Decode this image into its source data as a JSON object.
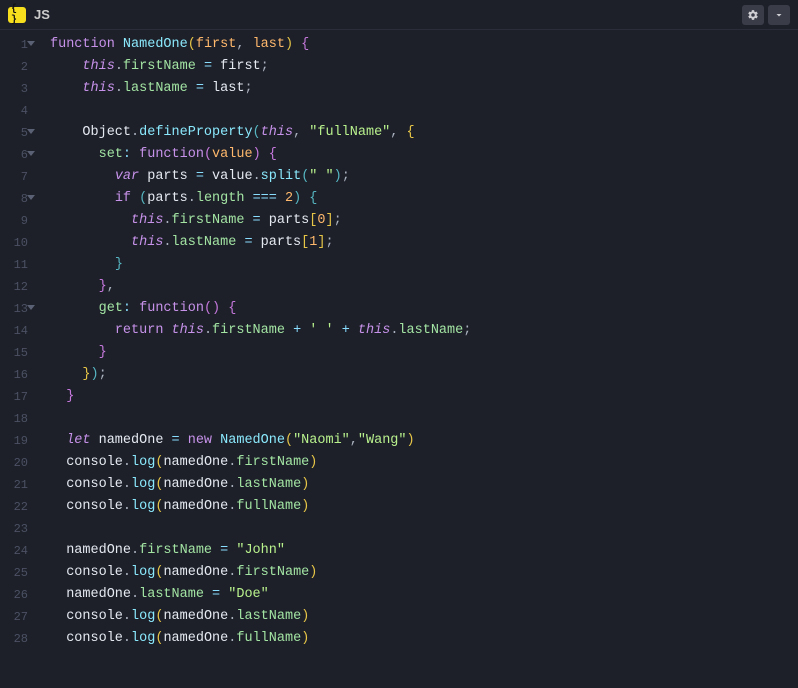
{
  "titlebar": {
    "js_badge": "{ }",
    "js_label": "JS"
  },
  "lines": [
    {
      "n": 1,
      "fold": true,
      "tokens": [
        [
          "kw",
          "function "
        ],
        [
          "fn",
          "NamedOne"
        ],
        [
          "paren",
          "("
        ],
        [
          "var",
          "first"
        ],
        [
          "punc",
          ", "
        ],
        [
          "var",
          "last"
        ],
        [
          "paren",
          ") "
        ],
        [
          "paren2",
          "{"
        ]
      ]
    },
    {
      "n": 2,
      "fold": false,
      "tokens": [
        [
          "",
          "    "
        ],
        [
          "this",
          "this"
        ],
        [
          "punc",
          "."
        ],
        [
          "prop",
          "firstName"
        ],
        [
          "op",
          " = "
        ],
        [
          "ident",
          "first"
        ],
        [
          "punc",
          ";"
        ]
      ]
    },
    {
      "n": 3,
      "fold": false,
      "tokens": [
        [
          "",
          "    "
        ],
        [
          "this",
          "this"
        ],
        [
          "punc",
          "."
        ],
        [
          "prop",
          "lastName"
        ],
        [
          "op",
          " = "
        ],
        [
          "ident",
          "last"
        ],
        [
          "punc",
          ";"
        ]
      ]
    },
    {
      "n": 4,
      "fold": false,
      "tokens": []
    },
    {
      "n": 5,
      "fold": true,
      "tokens": [
        [
          "",
          "    "
        ],
        [
          "ident",
          "Object"
        ],
        [
          "punc",
          "."
        ],
        [
          "fn",
          "defineProperty"
        ],
        [
          "paren3",
          "("
        ],
        [
          "this",
          "this"
        ],
        [
          "punc",
          ", "
        ],
        [
          "str",
          "\"fullName\""
        ],
        [
          "punc",
          ", "
        ],
        [
          "paren",
          "{"
        ]
      ]
    },
    {
      "n": 6,
      "fold": true,
      "tokens": [
        [
          "",
          "      "
        ],
        [
          "prop",
          "set"
        ],
        [
          "op",
          ": "
        ],
        [
          "kw",
          "function"
        ],
        [
          "paren2",
          "("
        ],
        [
          "var",
          "value"
        ],
        [
          "paren2",
          ") "
        ],
        [
          "paren2",
          "{"
        ]
      ]
    },
    {
      "n": 7,
      "fold": false,
      "tokens": [
        [
          "",
          "        "
        ],
        [
          "kw2",
          "var "
        ],
        [
          "ident",
          "parts"
        ],
        [
          "op",
          " = "
        ],
        [
          "ident",
          "value"
        ],
        [
          "punc",
          "."
        ],
        [
          "fn",
          "split"
        ],
        [
          "paren3",
          "("
        ],
        [
          "str",
          "\" \""
        ],
        [
          "paren3",
          ")"
        ],
        [
          "punc",
          ";"
        ]
      ]
    },
    {
      "n": 8,
      "fold": true,
      "tokens": [
        [
          "",
          "        "
        ],
        [
          "kw",
          "if "
        ],
        [
          "paren3",
          "("
        ],
        [
          "ident",
          "parts"
        ],
        [
          "punc",
          "."
        ],
        [
          "prop",
          "length"
        ],
        [
          "op",
          " === "
        ],
        [
          "num",
          "2"
        ],
        [
          "paren3",
          ") "
        ],
        [
          "paren3",
          "{"
        ]
      ]
    },
    {
      "n": 9,
      "fold": false,
      "tokens": [
        [
          "",
          "          "
        ],
        [
          "this",
          "this"
        ],
        [
          "punc",
          "."
        ],
        [
          "prop",
          "firstName"
        ],
        [
          "op",
          " = "
        ],
        [
          "ident",
          "parts"
        ],
        [
          "paren",
          "["
        ],
        [
          "num",
          "0"
        ],
        [
          "paren",
          "]"
        ],
        [
          "punc",
          ";"
        ]
      ]
    },
    {
      "n": 10,
      "fold": false,
      "tokens": [
        [
          "",
          "          "
        ],
        [
          "this",
          "this"
        ],
        [
          "punc",
          "."
        ],
        [
          "prop",
          "lastName"
        ],
        [
          "op",
          " = "
        ],
        [
          "ident",
          "parts"
        ],
        [
          "paren",
          "["
        ],
        [
          "num",
          "1"
        ],
        [
          "paren",
          "]"
        ],
        [
          "punc",
          ";"
        ]
      ]
    },
    {
      "n": 11,
      "fold": false,
      "tokens": [
        [
          "",
          "        "
        ],
        [
          "paren3",
          "}"
        ]
      ]
    },
    {
      "n": 12,
      "fold": false,
      "tokens": [
        [
          "",
          "      "
        ],
        [
          "paren2",
          "}"
        ],
        [
          "punc",
          ","
        ]
      ]
    },
    {
      "n": 13,
      "fold": true,
      "tokens": [
        [
          "",
          "      "
        ],
        [
          "prop",
          "get"
        ],
        [
          "op",
          ": "
        ],
        [
          "kw",
          "function"
        ],
        [
          "paren2",
          "("
        ],
        [
          "paren2",
          ") "
        ],
        [
          "paren2",
          "{"
        ]
      ]
    },
    {
      "n": 14,
      "fold": false,
      "tokens": [
        [
          "",
          "        "
        ],
        [
          "kw",
          "return "
        ],
        [
          "this",
          "this"
        ],
        [
          "punc",
          "."
        ],
        [
          "prop",
          "firstName"
        ],
        [
          "op",
          " + "
        ],
        [
          "str",
          "' '"
        ],
        [
          "op",
          " + "
        ],
        [
          "this",
          "this"
        ],
        [
          "punc",
          "."
        ],
        [
          "prop",
          "lastName"
        ],
        [
          "punc",
          ";"
        ]
      ]
    },
    {
      "n": 15,
      "fold": false,
      "tokens": [
        [
          "",
          "      "
        ],
        [
          "paren2",
          "}"
        ]
      ]
    },
    {
      "n": 16,
      "fold": false,
      "tokens": [
        [
          "",
          "    "
        ],
        [
          "paren",
          "}"
        ],
        [
          "paren3",
          ")"
        ],
        [
          "punc",
          ";"
        ]
      ]
    },
    {
      "n": 17,
      "fold": false,
      "tokens": [
        [
          "",
          "  "
        ],
        [
          "paren2",
          "}"
        ]
      ]
    },
    {
      "n": 18,
      "fold": false,
      "tokens": []
    },
    {
      "n": 19,
      "fold": false,
      "tokens": [
        [
          "",
          "  "
        ],
        [
          "kw2",
          "let "
        ],
        [
          "ident",
          "namedOne"
        ],
        [
          "op",
          " = "
        ],
        [
          "kw",
          "new "
        ],
        [
          "fn",
          "NamedOne"
        ],
        [
          "paren",
          "("
        ],
        [
          "str",
          "\"Naomi\""
        ],
        [
          "punc",
          ","
        ],
        [
          "str",
          "\"Wang\""
        ],
        [
          "paren",
          ")"
        ]
      ]
    },
    {
      "n": 20,
      "fold": false,
      "tokens": [
        [
          "",
          "  "
        ],
        [
          "ident",
          "console"
        ],
        [
          "punc",
          "."
        ],
        [
          "fn",
          "log"
        ],
        [
          "paren",
          "("
        ],
        [
          "ident",
          "namedOne"
        ],
        [
          "punc",
          "."
        ],
        [
          "prop",
          "firstName"
        ],
        [
          "paren",
          ")"
        ]
      ]
    },
    {
      "n": 21,
      "fold": false,
      "tokens": [
        [
          "",
          "  "
        ],
        [
          "ident",
          "console"
        ],
        [
          "punc",
          "."
        ],
        [
          "fn",
          "log"
        ],
        [
          "paren",
          "("
        ],
        [
          "ident",
          "namedOne"
        ],
        [
          "punc",
          "."
        ],
        [
          "prop",
          "lastName"
        ],
        [
          "paren",
          ")"
        ]
      ]
    },
    {
      "n": 22,
      "fold": false,
      "tokens": [
        [
          "",
          "  "
        ],
        [
          "ident",
          "console"
        ],
        [
          "punc",
          "."
        ],
        [
          "fn",
          "log"
        ],
        [
          "paren",
          "("
        ],
        [
          "ident",
          "namedOne"
        ],
        [
          "punc",
          "."
        ],
        [
          "prop",
          "fullName"
        ],
        [
          "paren",
          ")"
        ]
      ]
    },
    {
      "n": 23,
      "fold": false,
      "tokens": []
    },
    {
      "n": 24,
      "fold": false,
      "tokens": [
        [
          "",
          "  "
        ],
        [
          "ident",
          "namedOne"
        ],
        [
          "punc",
          "."
        ],
        [
          "prop",
          "firstName"
        ],
        [
          "op",
          " = "
        ],
        [
          "str",
          "\"John\""
        ]
      ]
    },
    {
      "n": 25,
      "fold": false,
      "tokens": [
        [
          "",
          "  "
        ],
        [
          "ident",
          "console"
        ],
        [
          "punc",
          "."
        ],
        [
          "fn",
          "log"
        ],
        [
          "paren",
          "("
        ],
        [
          "ident",
          "namedOne"
        ],
        [
          "punc",
          "."
        ],
        [
          "prop",
          "firstName"
        ],
        [
          "paren",
          ")"
        ]
      ]
    },
    {
      "n": 26,
      "fold": false,
      "tokens": [
        [
          "",
          "  "
        ],
        [
          "ident",
          "namedOne"
        ],
        [
          "punc",
          "."
        ],
        [
          "prop",
          "lastName"
        ],
        [
          "op",
          " = "
        ],
        [
          "str",
          "\"Doe\""
        ]
      ]
    },
    {
      "n": 27,
      "fold": false,
      "tokens": [
        [
          "",
          "  "
        ],
        [
          "ident",
          "console"
        ],
        [
          "punc",
          "."
        ],
        [
          "fn",
          "log"
        ],
        [
          "paren",
          "("
        ],
        [
          "ident",
          "namedOne"
        ],
        [
          "punc",
          "."
        ],
        [
          "prop",
          "lastName"
        ],
        [
          "paren",
          ")"
        ]
      ]
    },
    {
      "n": 28,
      "fold": false,
      "tokens": [
        [
          "",
          "  "
        ],
        [
          "ident",
          "console"
        ],
        [
          "punc",
          "."
        ],
        [
          "fn",
          "log"
        ],
        [
          "paren",
          "("
        ],
        [
          "ident",
          "namedOne"
        ],
        [
          "punc",
          "."
        ],
        [
          "prop",
          "fullName"
        ],
        [
          "paren",
          ")"
        ]
      ]
    }
  ]
}
